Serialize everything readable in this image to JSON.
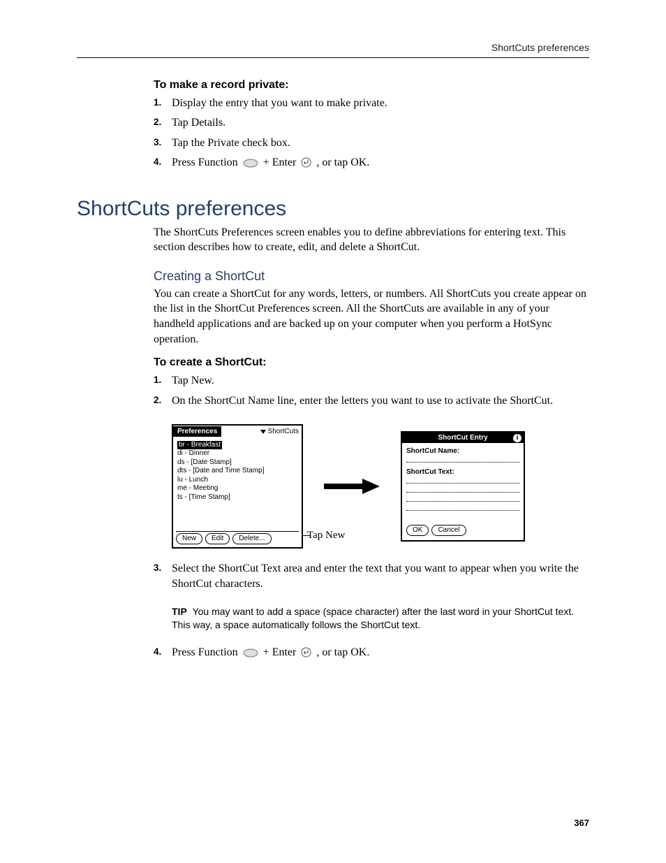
{
  "header": {
    "running": "ShortCuts preferences"
  },
  "proc1": {
    "heading": "To make a record private:",
    "step1": "Display the entry that you want to make private.",
    "step2": "Tap Details.",
    "step3": "Tap the Private check box.",
    "step4_pre": "Press Function ",
    "step4_mid": " + Enter ",
    "step4_post": ", or tap OK."
  },
  "section": {
    "title": "ShortCuts preferences",
    "intro": "The ShortCuts Preferences screen enables you to define abbreviations for entering text. This section describes how to create, edit, and delete a ShortCut.",
    "sub": "Creating a ShortCut",
    "subtext": "You can create a ShortCut for any words, letters, or numbers. All ShortCuts you create appear on the list in the ShortCut Preferences screen. All the ShortCuts are available in any of your handheld applications and are backed up on your computer when you perform a HotSync operation."
  },
  "proc2": {
    "heading": "To create a ShortCut:",
    "step1": "Tap New.",
    "step2": "On the ShortCut Name line, enter the letters you want to use to activate the ShortCut.",
    "step3": "Select the ShortCut Text area and enter the text that you want to appear when you write the ShortCut characters.",
    "step4_pre": "Press Function ",
    "step4_mid": " + Enter ",
    "step4_post": ", or tap OK."
  },
  "tip": {
    "label": "TIP",
    "text": "You may want to add a space (space character) after the last word in your ShortCut text. This way, a space automatically follows the ShortCut text."
  },
  "figure": {
    "prefs": {
      "title": "Preferences",
      "dropdown": "ShortCuts",
      "items": [
        "br - Breakfast",
        "di - Dinner",
        "ds - [Date Stamp]",
        "dts - [Date and Time Stamp]",
        "lu - Lunch",
        "me - Meeting",
        "ts - [Time Stamp]"
      ],
      "btn_new": "New",
      "btn_edit": "Edit",
      "btn_delete": "Delete..."
    },
    "callout": "Tap New",
    "entry": {
      "title": "ShortCut Entry",
      "name_label": "ShortCut Name:",
      "text_label": "ShortCut Text:",
      "btn_ok": "OK",
      "btn_cancel": "Cancel"
    }
  },
  "page_number": "367"
}
